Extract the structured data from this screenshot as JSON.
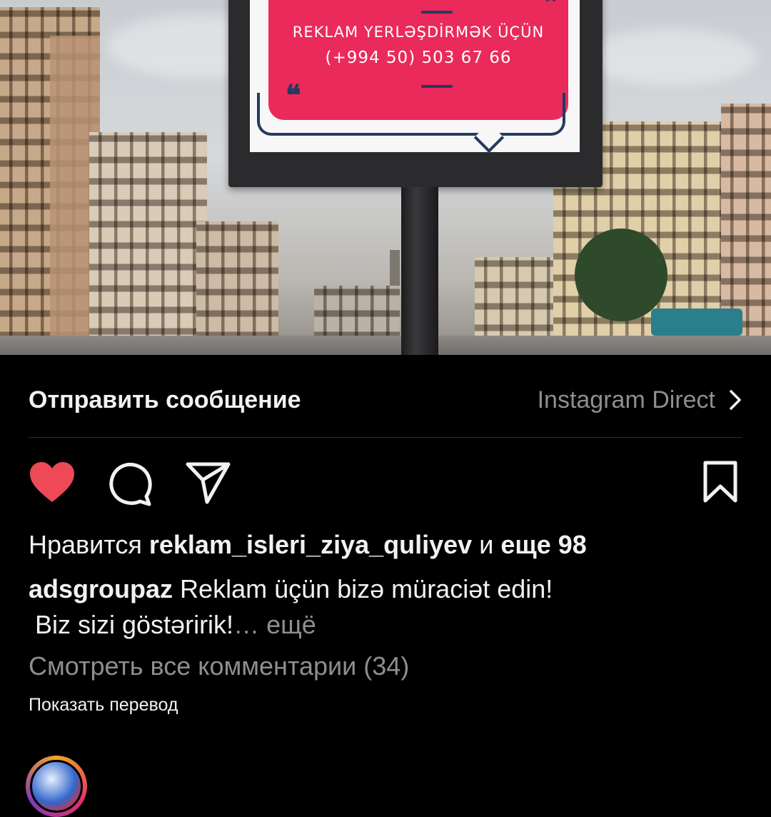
{
  "billboard": {
    "line1": "REKLAM YERLƏŞDİRMƏK ÜÇÜN",
    "line2": "(+994 50) 503 67 66"
  },
  "share": {
    "send_label": "Отправить сообщение",
    "direct_label": "Instagram Direct"
  },
  "post": {
    "liked_prefix": "Нравится",
    "liked_user": "reklam_isleri_ziya_quliyev",
    "liked_and": "и",
    "liked_more": "еще 98",
    "author": "adsgroupaz",
    "caption_line1": "Reklam üçün bizə müraciət edin!",
    "caption_line2": "Biz sizi göstəririk!",
    "more_label": "… ещё",
    "view_comments": "Смотреть все комментарии (34)",
    "show_translation": "Показать перевод"
  },
  "colors": {
    "like_red": "#ed4956",
    "background": "#000000",
    "muted_text": "#8e8e8e",
    "billboard_pink": "#ea2a5a"
  },
  "icons": {
    "like": "heart-icon",
    "comment": "comment-icon",
    "share": "paper-plane-icon",
    "save": "bookmark-icon",
    "direct": "chevron-right-icon"
  }
}
